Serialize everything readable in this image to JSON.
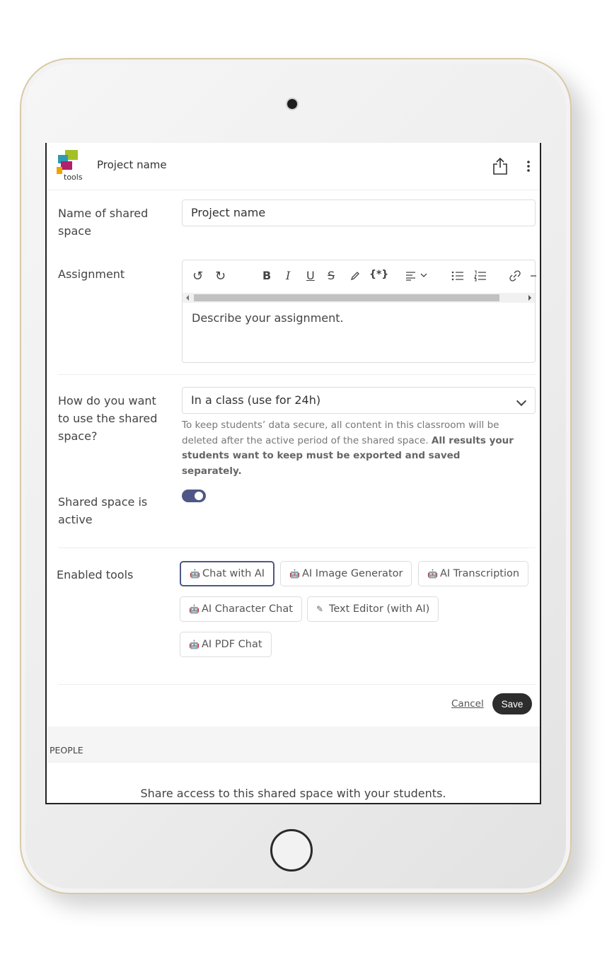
{
  "header": {
    "logo_text": "tools",
    "title": "Project name"
  },
  "form": {
    "name_label": "Name of shared space",
    "name_value": "Project name",
    "assignment_label": "Assignment",
    "assignment_placeholder": "Describe your assignment.",
    "toolbar": {
      "undo": "↺",
      "redo": "↻",
      "bold": "B",
      "italic": "I",
      "underline": "U",
      "strike": "S",
      "variable": "{*}"
    },
    "usage_label": "How do you want to use the shared space?",
    "usage_value": "In a class (use for 24h)",
    "usage_note_plain": "To keep students’ data secure, all content in this classroom will be deleted after the active period of the shared space. ",
    "usage_note_bold": "All results your students want to keep must be exported and saved separately.",
    "active_label": "Shared space is active",
    "active_on": true,
    "tools_label": "Enabled tools",
    "tools": [
      {
        "label": "Chat with AI",
        "selected": true,
        "icon": "robot-icon"
      },
      {
        "label": "AI Image Generator",
        "selected": false,
        "icon": "robot-icon"
      },
      {
        "label": "AI Transcription",
        "selected": false,
        "icon": "robot-icon"
      },
      {
        "label": "AI Character Chat",
        "selected": false,
        "icon": "robot-icon"
      },
      {
        "label": "Text Editor (with AI)",
        "selected": false,
        "icon": "edit-icon"
      },
      {
        "label": "AI PDF Chat",
        "selected": false,
        "icon": "robot-icon"
      }
    ],
    "cancel_label": "Cancel",
    "save_label": "Save"
  },
  "people": {
    "section_label": "PEOPLE",
    "share_text": "Share access to this shared space with your students."
  },
  "colors": {
    "accent": "#4e5786",
    "save_bg": "#2d2d2d"
  }
}
